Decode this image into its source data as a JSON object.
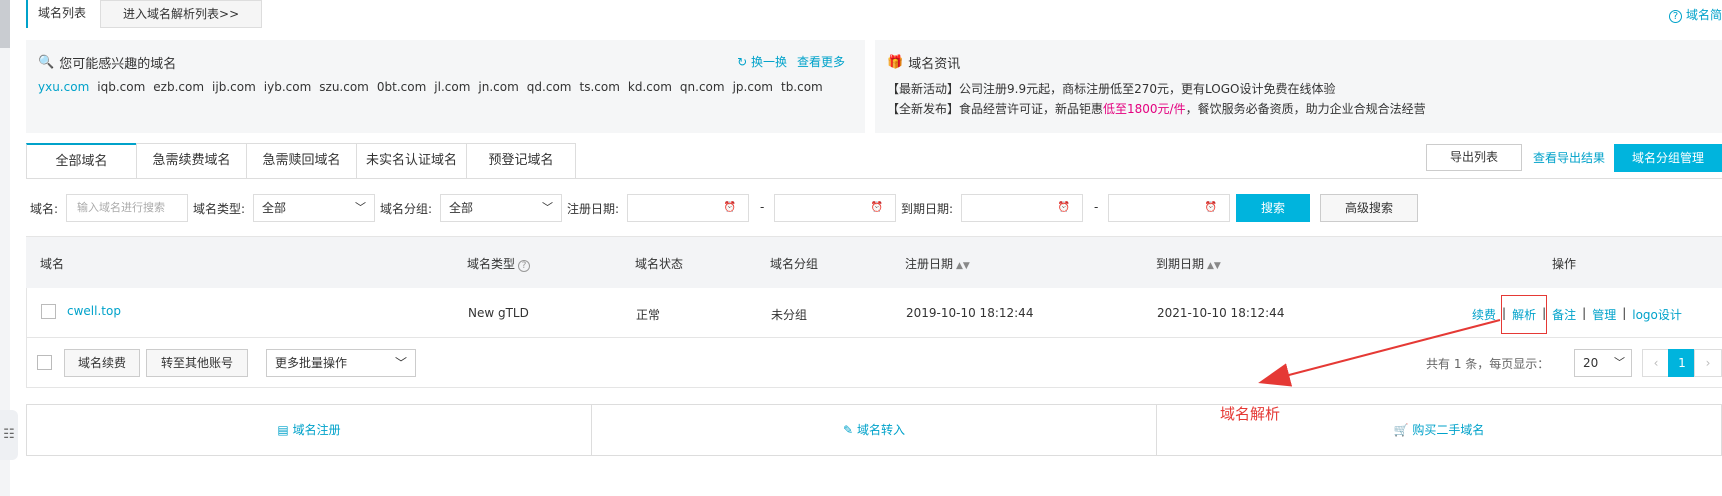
{
  "top_tabs": {
    "active": "域名列表",
    "button": "进入域名解析列表>>"
  },
  "help": {
    "label": "域名简"
  },
  "interest": {
    "title": "您可能感兴趣的域名",
    "shuffle": "换一换",
    "more": "查看更多",
    "domains": [
      "yxu.com",
      "iqb.com",
      "ezb.com",
      "ijb.com",
      "iyb.com",
      "szu.com",
      "0bt.com",
      "jl.com",
      "jn.com",
      "qd.com",
      "ts.com",
      "kd.com",
      "qn.com",
      "jp.com",
      "tb.com"
    ]
  },
  "news": {
    "title": "域名资讯",
    "line1": "【最新活动】公司注册9.9元起，商标注册低至270元，更有LOGO设计免费在线体验",
    "line2_pre": "【全新发布】食品经营许可证，新品钜惠",
    "line2_hl": "低至1800元/件",
    "line2_post": "，餐饮服务必备资质，助力企业合规合法经营"
  },
  "tabs": [
    "全部域名",
    "急需续费域名",
    "急需赎回域名",
    "未实名认证域名",
    "预登记域名"
  ],
  "toolbar": {
    "export": "导出列表",
    "export_result": "查看导出结果",
    "group_mgmt": "域名分组管理"
  },
  "filter": {
    "domain_label": "域名:",
    "domain_placeholder": "输入域名进行搜索",
    "type_label": "域名类型:",
    "type_value": "全部",
    "group_label": "域名分组:",
    "group_value": "全部",
    "reg_label": "注册日期:",
    "exp_label": "到期日期:",
    "dash": "-",
    "search": "搜索",
    "advanced": "高级搜索"
  },
  "table": {
    "headers": {
      "domain": "域名",
      "type": "域名类型",
      "status": "域名状态",
      "group": "域名分组",
      "reg": "注册日期",
      "exp": "到期日期",
      "ops": "操作"
    },
    "row": {
      "domain": "cwell.top",
      "type": "New gTLD",
      "status": "正常",
      "group": "未分组",
      "reg": "2019-10-10 18:12:44",
      "exp": "2021-10-10 18:12:44",
      "ops": [
        "续费",
        "解析",
        "备注",
        "管理",
        "logo设计"
      ],
      "op_sep": "|"
    }
  },
  "batch": {
    "renew": "域名续费",
    "transfer": "转至其他账号",
    "more": "更多批量操作"
  },
  "pager": {
    "summary": "共有 1 条，每页显示：",
    "size": "20",
    "current": "1",
    "prev": "‹",
    "next": "›"
  },
  "footer": {
    "register": "域名注册",
    "transfer_in": "域名转入",
    "buy": "购买二手域名"
  },
  "annotation": {
    "label": "域名解析",
    "color": "#e53935"
  },
  "colors": {
    "accent": "#00a2ca",
    "primary_btn": "#00b4dd",
    "highlight": "#e4007f"
  }
}
